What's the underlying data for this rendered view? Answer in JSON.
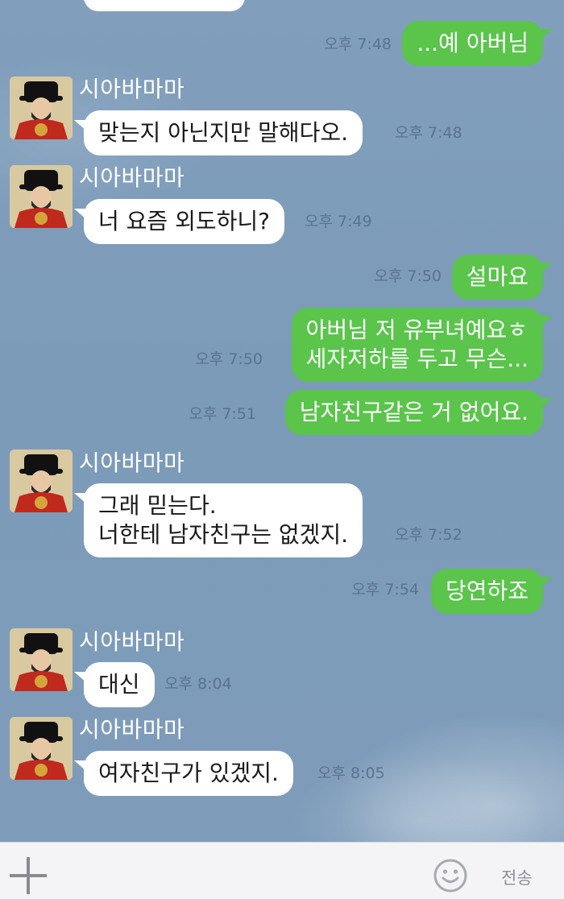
{
  "contact": {
    "name": "시아바마마"
  },
  "messages": [
    {
      "from": "me",
      "text_lines": [
        "...예 아버님"
      ],
      "time": "오후 7:48"
    },
    {
      "from": "them",
      "sender": "시아바마마",
      "text_lines": [
        "맞는지 아닌지만 말해다오."
      ],
      "time": "오후 7:48"
    },
    {
      "from": "them",
      "sender": "시아바마마",
      "text_lines": [
        "너 요즘 외도하니?"
      ],
      "time": "오후 7:49"
    },
    {
      "from": "me",
      "text_lines": [
        "설마요"
      ],
      "time": "오후 7:50"
    },
    {
      "from": "me",
      "text_lines": [
        "아버님 저 유부녀예요ㅎ",
        "세자저하를 두고 무슨..."
      ],
      "time": "오후 7:50"
    },
    {
      "from": "me",
      "text_lines": [
        "남자친구같은 거 없어요."
      ],
      "time": "오후 7:51"
    },
    {
      "from": "them",
      "sender": "시아바마마",
      "text_lines": [
        "그래 믿는다.",
        "너한테 남자친구는 없겠지."
      ],
      "time": "오후 7:52"
    },
    {
      "from": "me",
      "text_lines": [
        "당연하죠"
      ],
      "time": "오후 7:54"
    },
    {
      "from": "them",
      "sender": "시아바마마",
      "text_lines": [
        "대신"
      ],
      "time": "오후 8:04"
    },
    {
      "from": "them",
      "sender": "시아바마마",
      "text_lines": [
        "여자친구가 있겠지."
      ],
      "time": "오후 8:05"
    }
  ],
  "composer": {
    "plus_icon": "plus-icon",
    "emoji_icon": "smiley-icon",
    "send_label": "전송"
  },
  "colors": {
    "background": "#7f9fbd",
    "outgoing_bubble": "#5ac44b",
    "incoming_bubble": "#ffffff"
  }
}
